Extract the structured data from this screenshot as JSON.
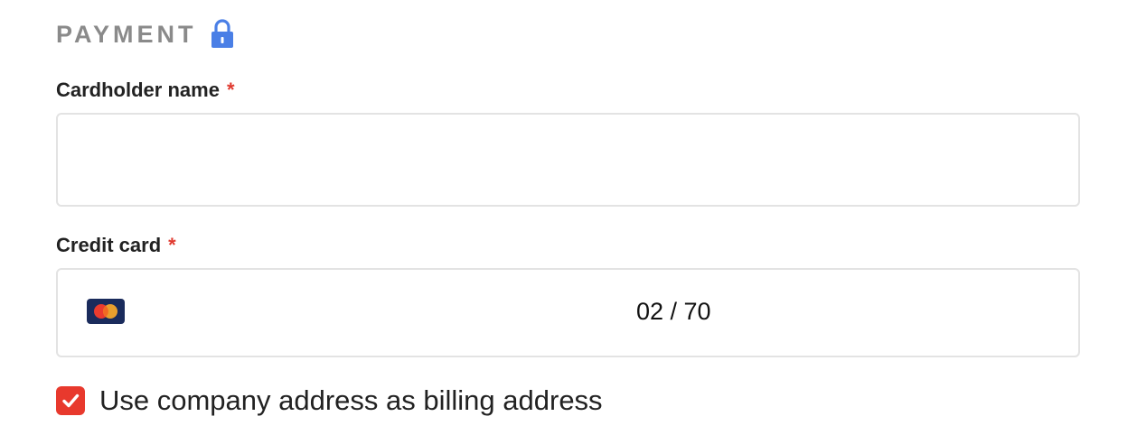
{
  "payment": {
    "title": "PAYMENT",
    "title_icon": "lock-icon",
    "accent_color": "#4a7fe6"
  },
  "cardholder": {
    "label": "Cardholder name",
    "required_marker": "*",
    "value": "",
    "placeholder": ""
  },
  "credit_card": {
    "label": "Credit card",
    "required_marker": "*",
    "brand_icon": "mastercard-icon",
    "expiry": "02 / 70"
  },
  "billing": {
    "checkbox_checked": true,
    "checkbox_color": "#e8392d",
    "label": "Use company address as billing address"
  },
  "colors": {
    "required": "#e03a2f",
    "section_title": "#8a8a8a",
    "border": "#e3e3e3"
  }
}
